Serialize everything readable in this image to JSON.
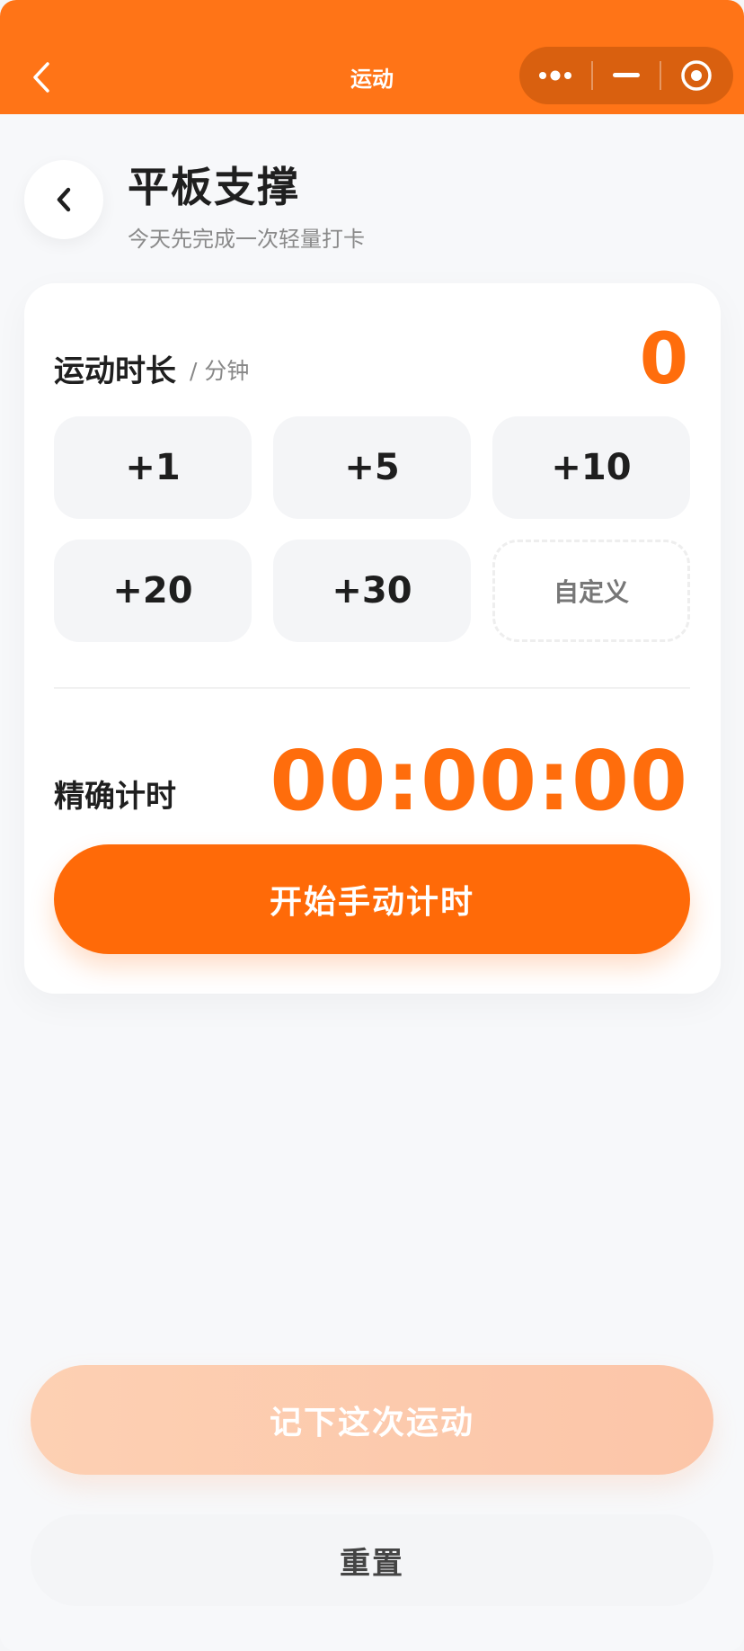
{
  "nav": {
    "title": "运动"
  },
  "header": {
    "title": "平板支撑",
    "subtitle": "今天先完成一次轻量打卡"
  },
  "duration": {
    "label": "运动时长",
    "unit": "/ 分钟",
    "value": "0",
    "chips": [
      "+1",
      "+5",
      "+10",
      "+20",
      "+30"
    ],
    "custom_label": "自定义"
  },
  "timer": {
    "label": "精确计时",
    "value": "00:00:00",
    "start_label": "开始手动计时"
  },
  "actions": {
    "record_label": "记下这次运动",
    "reset_label": "重置"
  },
  "colors": {
    "accent": "#ff6d0c",
    "nav_bg": "#ff7417",
    "record_bg": "#fdd0b3"
  }
}
